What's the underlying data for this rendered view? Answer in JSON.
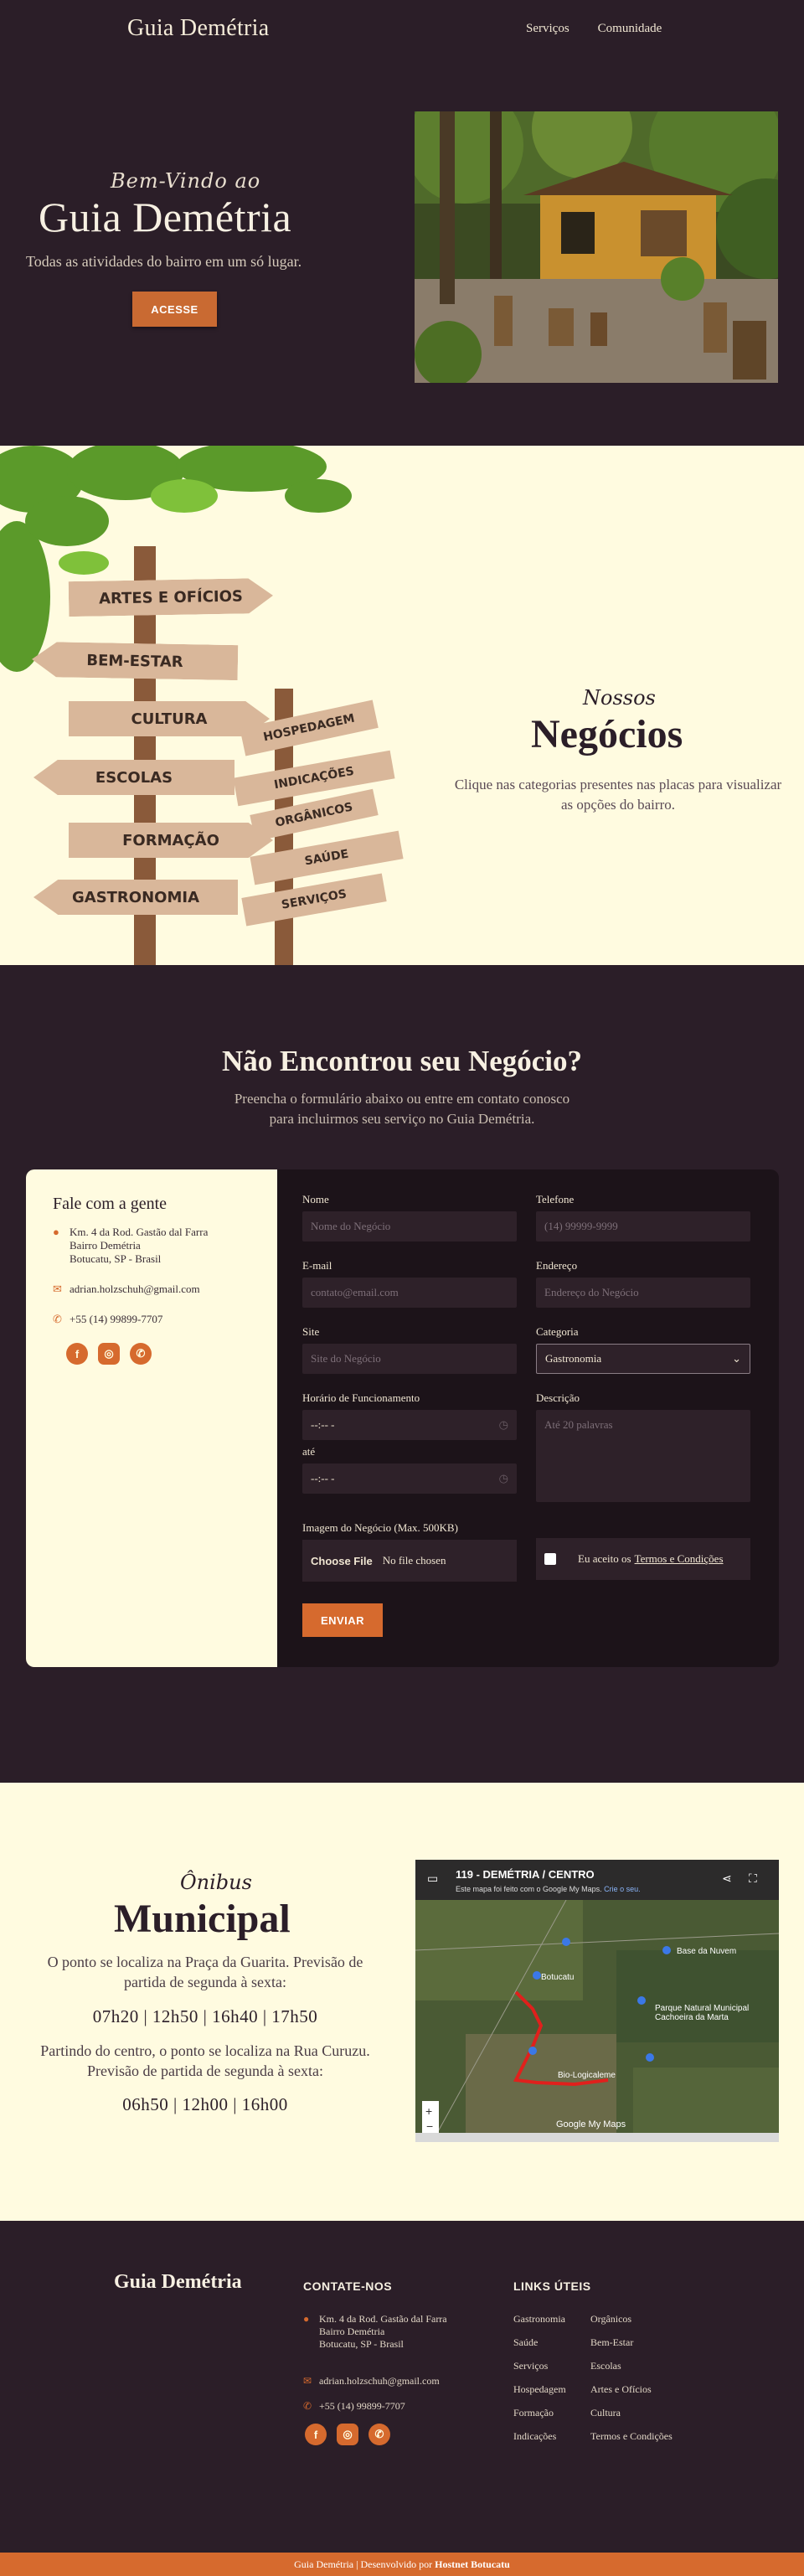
{
  "header": {
    "brand": "Guia Demétria",
    "nav": [
      "Serviços",
      "Comunidade"
    ]
  },
  "hero": {
    "script": "Bem-Vindo ao",
    "title": "Guia Demétria",
    "subtitle": "Todas as atividades do bairro em um só lugar.",
    "button": "ACESSE"
  },
  "negocios": {
    "script": "Nossos",
    "title": "Negócios",
    "description": "Clique nas categorias presentes nas placas para visualizar as opções do bairro.",
    "signs": [
      "ARTES E OFÍCIOS",
      "BEM-ESTAR",
      "CULTURA",
      "HOSPEDAGEM",
      "ESCOLAS",
      "INDICAÇÕES",
      "ORGÂNICOS",
      "FORMAÇÃO",
      "SAÚDE",
      "GASTRONOMIA",
      "SERVIÇOS"
    ]
  },
  "form_section": {
    "title": "Não Encontrou seu Negócio?",
    "lead_line1": "Preencha o formulário abaixo ou entre em contato conosco",
    "lead_line2": "para incluirmos seu serviço no Guia Demétria."
  },
  "contact": {
    "title": "Fale com a gente",
    "address_line1": "Km. 4 da Rod. Gastão dal Farra",
    "address_line2": "Bairro Demétria",
    "address_line3": "Botucatu, SP - Brasil",
    "email": "adrian.holzschuh@gmail.com",
    "phone": "+55 (14) 99899-7707"
  },
  "form": {
    "nome_label": "Nome",
    "nome_placeholder": "Nome do Negócio",
    "telefone_label": "Telefone",
    "telefone_placeholder": "(14) 99999-9999",
    "email_label": "E-mail",
    "email_placeholder": "contato@email.com",
    "endereco_label": "Endereço",
    "endereco_placeholder": "Endereço do Negócio",
    "site_label": "Site",
    "site_placeholder": "Site do Negócio",
    "categoria_label": "Categoria",
    "categoria_value": "Gastronomia",
    "horario_label": "Horário de Funcionamento",
    "time1_value": "--:-- -",
    "ate_label": "até",
    "time2_value": "--:-- -",
    "descricao_label": "Descrição",
    "descricao_placeholder": "Até 20 palavras",
    "imagem_label": "Imagem do Negócio (Max. 500KB)",
    "file_button": "Choose File",
    "file_status": "No file chosen",
    "terms_prefix": "Eu aceito os",
    "terms_link": "Termos e Condições",
    "submit": "ENVIAR"
  },
  "bus": {
    "script": "Ônibus",
    "title": "Municipal",
    "p1": "O ponto se localiza na Praça da Guarita. Previsão de partida de segunda à sexta:",
    "times1": "07h20 | 12h50 | 16h40 | 17h50",
    "p2": "Partindo do centro, o ponto se localiza na Rua Curuzu. Previsão de partida de segunda à sexta:",
    "times2": "06h50 | 12h00 | 16h00",
    "map_title": "119 - DEMÉTRIA / CENTRO",
    "map_subtitle": "Este mapa foi feito com o Google My Maps.",
    "map_link": "Crie o seu.",
    "map_labels": [
      "Base da Nuvem",
      "Parque Natural Municipal Cachoeira da Marta",
      "Botucatu",
      "Bio-Logicaleme",
      "Google My Maps"
    ]
  },
  "footer": {
    "brand": "Guia Demétria",
    "contact_title": "CONTATE-NOS",
    "links_title": "LINKS ÚTEIS",
    "address_line1": "Km. 4 da Rod. Gastão dal Farra",
    "address_line2": "Bairro Demétria",
    "address_line3": "Botucatu, SP - Brasil",
    "email": "adrian.holzschuh@gmail.com",
    "phone": "+55 (14) 99899-7707",
    "links_col1": [
      "Gastronomia",
      "Saúde",
      "Serviços",
      "Hospedagem",
      "Formação",
      "Indicações"
    ],
    "links_col2": [
      "Orgânicos",
      "Bem-Estar",
      "Escolas",
      "Artes e Ofícios",
      "Cultura",
      "Termos e Condições"
    ],
    "bottom_prefix": "Guia Demétria | Desenvolvido por",
    "bottom_brand": "Hostnet Botucatu"
  },
  "colors": {
    "dark": "#2b1e28",
    "cream": "#fffbe0",
    "accent": "#d66a2e"
  }
}
